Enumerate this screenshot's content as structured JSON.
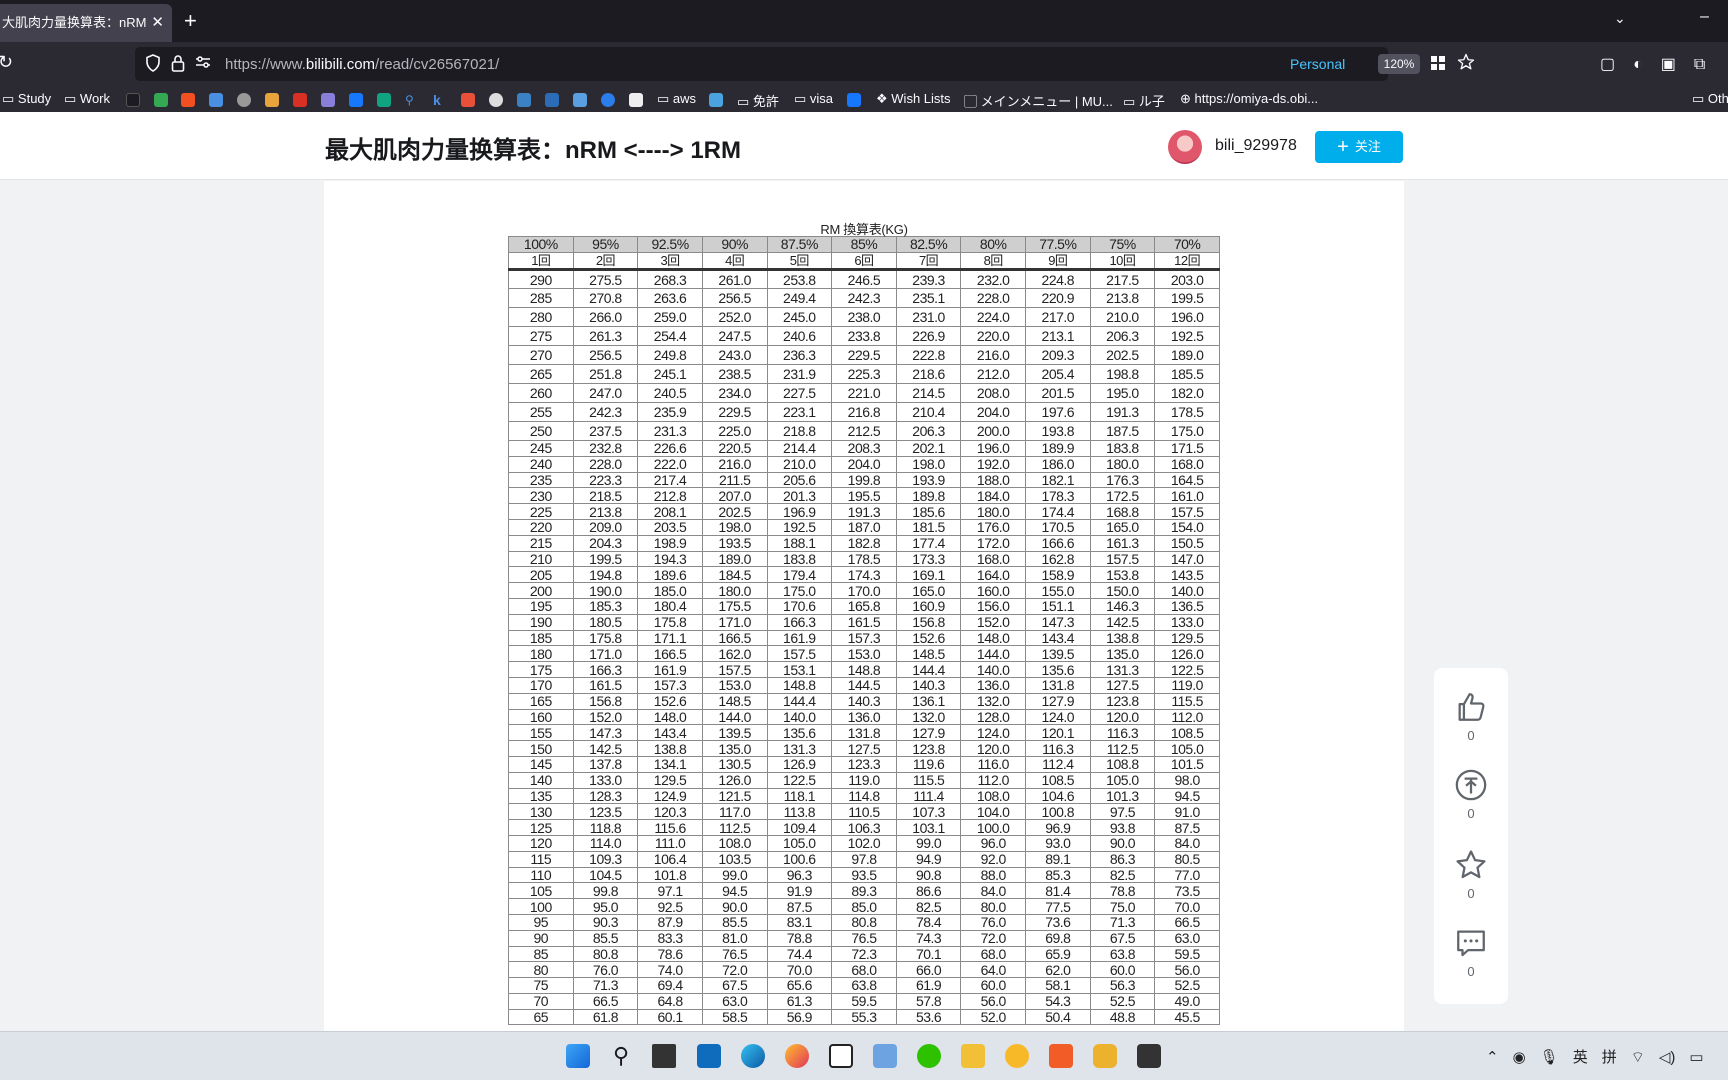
{
  "browser": {
    "tab_title": "大肌肉力量换算表：nRM <-",
    "tab_close": "✕",
    "new_tab": "+",
    "url_prefix": "https://www.",
    "url_domain": "bilibili.com",
    "url_path": "/read/cv26567021/",
    "container_label": "Personal",
    "zoom": "120%"
  },
  "bookmarks": [
    "Study",
    "Work",
    "aws",
    "免許",
    "visa",
    "Wish Lists",
    "メインメニュー | MU...",
    "ル子",
    "https://omiya-ds.obi...",
    "Oth"
  ],
  "article": {
    "title": "最大肌肉力量换算表：nRM <----> 1RM",
    "author": "bili_929978",
    "follow_label": "关注",
    "follow_icon": "plus-icon"
  },
  "rm_table": {
    "caption": "RM 換算表(KG)",
    "percents": [
      "100%",
      "95%",
      "92.5%",
      "90%",
      "87.5%",
      "85%",
      "82.5%",
      "80%",
      "77.5%",
      "75%",
      "70%"
    ],
    "reps": [
      "1回",
      "2回",
      "3回",
      "4回",
      "5回",
      "6回",
      "7回",
      "8回",
      "9回",
      "10回",
      "12回"
    ],
    "rows": [
      [
        "290",
        "275.5",
        "268.3",
        "261.0",
        "253.8",
        "246.5",
        "239.3",
        "232.0",
        "224.8",
        "217.5",
        "203.0"
      ],
      [
        "285",
        "270.8",
        "263.6",
        "256.5",
        "249.4",
        "242.3",
        "235.1",
        "228.0",
        "220.9",
        "213.8",
        "199.5"
      ],
      [
        "280",
        "266.0",
        "259.0",
        "252.0",
        "245.0",
        "238.0",
        "231.0",
        "224.0",
        "217.0",
        "210.0",
        "196.0"
      ],
      [
        "275",
        "261.3",
        "254.4",
        "247.5",
        "240.6",
        "233.8",
        "226.9",
        "220.0",
        "213.1",
        "206.3",
        "192.5"
      ],
      [
        "270",
        "256.5",
        "249.8",
        "243.0",
        "236.3",
        "229.5",
        "222.8",
        "216.0",
        "209.3",
        "202.5",
        "189.0"
      ],
      [
        "265",
        "251.8",
        "245.1",
        "238.5",
        "231.9",
        "225.3",
        "218.6",
        "212.0",
        "205.4",
        "198.8",
        "185.5"
      ],
      [
        "260",
        "247.0",
        "240.5",
        "234.0",
        "227.5",
        "221.0",
        "214.5",
        "208.0",
        "201.5",
        "195.0",
        "182.0"
      ],
      [
        "255",
        "242.3",
        "235.9",
        "229.5",
        "223.1",
        "216.8",
        "210.4",
        "204.0",
        "197.6",
        "191.3",
        "178.5"
      ],
      [
        "250",
        "237.5",
        "231.3",
        "225.0",
        "218.8",
        "212.5",
        "206.3",
        "200.0",
        "193.8",
        "187.5",
        "175.0"
      ],
      [
        "245",
        "232.8",
        "226.6",
        "220.5",
        "214.4",
        "208.3",
        "202.1",
        "196.0",
        "189.9",
        "183.8",
        "171.5"
      ],
      [
        "240",
        "228.0",
        "222.0",
        "216.0",
        "210.0",
        "204.0",
        "198.0",
        "192.0",
        "186.0",
        "180.0",
        "168.0"
      ],
      [
        "235",
        "223.3",
        "217.4",
        "211.5",
        "205.6",
        "199.8",
        "193.9",
        "188.0",
        "182.1",
        "176.3",
        "164.5"
      ],
      [
        "230",
        "218.5",
        "212.8",
        "207.0",
        "201.3",
        "195.5",
        "189.8",
        "184.0",
        "178.3",
        "172.5",
        "161.0"
      ],
      [
        "225",
        "213.8",
        "208.1",
        "202.5",
        "196.9",
        "191.3",
        "185.6",
        "180.0",
        "174.4",
        "168.8",
        "157.5"
      ],
      [
        "220",
        "209.0",
        "203.5",
        "198.0",
        "192.5",
        "187.0",
        "181.5",
        "176.0",
        "170.5",
        "165.0",
        "154.0"
      ],
      [
        "215",
        "204.3",
        "198.9",
        "193.5",
        "188.1",
        "182.8",
        "177.4",
        "172.0",
        "166.6",
        "161.3",
        "150.5"
      ],
      [
        "210",
        "199.5",
        "194.3",
        "189.0",
        "183.8",
        "178.5",
        "173.3",
        "168.0",
        "162.8",
        "157.5",
        "147.0"
      ],
      [
        "205",
        "194.8",
        "189.6",
        "184.5",
        "179.4",
        "174.3",
        "169.1",
        "164.0",
        "158.9",
        "153.8",
        "143.5"
      ],
      [
        "200",
        "190.0",
        "185.0",
        "180.0",
        "175.0",
        "170.0",
        "165.0",
        "160.0",
        "155.0",
        "150.0",
        "140.0"
      ],
      [
        "195",
        "185.3",
        "180.4",
        "175.5",
        "170.6",
        "165.8",
        "160.9",
        "156.0",
        "151.1",
        "146.3",
        "136.5"
      ],
      [
        "190",
        "180.5",
        "175.8",
        "171.0",
        "166.3",
        "161.5",
        "156.8",
        "152.0",
        "147.3",
        "142.5",
        "133.0"
      ],
      [
        "185",
        "175.8",
        "171.1",
        "166.5",
        "161.9",
        "157.3",
        "152.6",
        "148.0",
        "143.4",
        "138.8",
        "129.5"
      ],
      [
        "180",
        "171.0",
        "166.5",
        "162.0",
        "157.5",
        "153.0",
        "148.5",
        "144.0",
        "139.5",
        "135.0",
        "126.0"
      ],
      [
        "175",
        "166.3",
        "161.9",
        "157.5",
        "153.1",
        "148.8",
        "144.4",
        "140.0",
        "135.6",
        "131.3",
        "122.5"
      ],
      [
        "170",
        "161.5",
        "157.3",
        "153.0",
        "148.8",
        "144.5",
        "140.3",
        "136.0",
        "131.8",
        "127.5",
        "119.0"
      ],
      [
        "165",
        "156.8",
        "152.6",
        "148.5",
        "144.4",
        "140.3",
        "136.1",
        "132.0",
        "127.9",
        "123.8",
        "115.5"
      ],
      [
        "160",
        "152.0",
        "148.0",
        "144.0",
        "140.0",
        "136.0",
        "132.0",
        "128.0",
        "124.0",
        "120.0",
        "112.0"
      ],
      [
        "155",
        "147.3",
        "143.4",
        "139.5",
        "135.6",
        "131.8",
        "127.9",
        "124.0",
        "120.1",
        "116.3",
        "108.5"
      ],
      [
        "150",
        "142.5",
        "138.8",
        "135.0",
        "131.3",
        "127.5",
        "123.8",
        "120.0",
        "116.3",
        "112.5",
        "105.0"
      ],
      [
        "145",
        "137.8",
        "134.1",
        "130.5",
        "126.9",
        "123.3",
        "119.6",
        "116.0",
        "112.4",
        "108.8",
        "101.5"
      ],
      [
        "140",
        "133.0",
        "129.5",
        "126.0",
        "122.5",
        "119.0",
        "115.5",
        "112.0",
        "108.5",
        "105.0",
        "98.0"
      ],
      [
        "135",
        "128.3",
        "124.9",
        "121.5",
        "118.1",
        "114.8",
        "111.4",
        "108.0",
        "104.6",
        "101.3",
        "94.5"
      ],
      [
        "130",
        "123.5",
        "120.3",
        "117.0",
        "113.8",
        "110.5",
        "107.3",
        "104.0",
        "100.8",
        "97.5",
        "91.0"
      ],
      [
        "125",
        "118.8",
        "115.6",
        "112.5",
        "109.4",
        "106.3",
        "103.1",
        "100.0",
        "96.9",
        "93.8",
        "87.5"
      ],
      [
        "120",
        "114.0",
        "111.0",
        "108.0",
        "105.0",
        "102.0",
        "99.0",
        "96.0",
        "93.0",
        "90.0",
        "84.0"
      ],
      [
        "115",
        "109.3",
        "106.4",
        "103.5",
        "100.6",
        "97.8",
        "94.9",
        "92.0",
        "89.1",
        "86.3",
        "80.5"
      ],
      [
        "110",
        "104.5",
        "101.8",
        "99.0",
        "96.3",
        "93.5",
        "90.8",
        "88.0",
        "85.3",
        "82.5",
        "77.0"
      ],
      [
        "105",
        "99.8",
        "97.1",
        "94.5",
        "91.9",
        "89.3",
        "86.6",
        "84.0",
        "81.4",
        "78.8",
        "73.5"
      ],
      [
        "100",
        "95.0",
        "92.5",
        "90.0",
        "87.5",
        "85.0",
        "82.5",
        "80.0",
        "77.5",
        "75.0",
        "70.0"
      ],
      [
        "95",
        "90.3",
        "87.9",
        "85.5",
        "83.1",
        "80.8",
        "78.4",
        "76.0",
        "73.6",
        "71.3",
        "66.5"
      ],
      [
        "90",
        "85.5",
        "83.3",
        "81.0",
        "78.8",
        "76.5",
        "74.3",
        "72.0",
        "69.8",
        "67.5",
        "63.0"
      ],
      [
        "85",
        "80.8",
        "78.6",
        "76.5",
        "74.4",
        "72.3",
        "70.1",
        "68.0",
        "65.9",
        "63.8",
        "59.5"
      ],
      [
        "80",
        "76.0",
        "74.0",
        "72.0",
        "70.0",
        "68.0",
        "66.0",
        "64.0",
        "62.0",
        "60.0",
        "56.0"
      ],
      [
        "75",
        "71.3",
        "69.4",
        "67.5",
        "65.6",
        "63.8",
        "61.9",
        "60.0",
        "58.1",
        "56.3",
        "52.5"
      ],
      [
        "70",
        "66.5",
        "64.8",
        "63.0",
        "61.3",
        "59.5",
        "57.8",
        "56.0",
        "54.3",
        "52.5",
        "49.0"
      ],
      [
        "65",
        "61.8",
        "60.1",
        "58.5",
        "56.9",
        "55.3",
        "53.6",
        "52.0",
        "50.4",
        "48.8",
        "45.5"
      ]
    ]
  },
  "actions": [
    {
      "name": "like",
      "icon": "thumbs-up-icon",
      "count": "0"
    },
    {
      "name": "coin",
      "icon": "coin-icon",
      "count": "0"
    },
    {
      "name": "favorite",
      "icon": "star-icon",
      "count": "0"
    },
    {
      "name": "comment",
      "icon": "comment-icon",
      "count": "0"
    }
  ],
  "taskbar": {
    "tray_ime_1": "英",
    "tray_ime_2": "拼"
  },
  "colors": {
    "accent": "#00aeec",
    "browser_dark": "#1c1b22",
    "table_header": "#cfcfcf"
  }
}
